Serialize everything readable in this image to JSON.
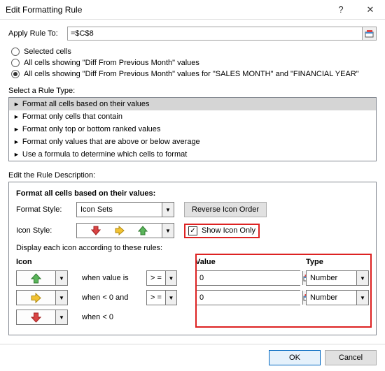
{
  "title": "Edit Formatting Rule",
  "apply": {
    "label": "Apply Rule To:",
    "value": "=$C$8"
  },
  "scope": {
    "opt1": "Selected cells",
    "opt2": "All cells showing \"Diff From Previous Month\" values",
    "opt3": "All cells showing \"Diff From Previous Month\" values for \"SALES MONTH\" and \"FINANCIAL YEAR\""
  },
  "select_type_label": "Select a Rule Type:",
  "rule_types": {
    "r0": "Format all cells based on their values",
    "r1": "Format only cells that contain",
    "r2": "Format only top or bottom ranked values",
    "r3": "Format only values that are above or below average",
    "r4": "Use a formula to determine which cells to format"
  },
  "edit_desc_label": "Edit the Rule Description:",
  "desc": {
    "heading": "Format all cells based on their values:",
    "format_style_label": "Format Style:",
    "format_style_value": "Icon Sets",
    "reverse_btn": "Reverse Icon Order",
    "icon_style_label": "Icon Style:",
    "show_icon_only": "Show Icon Only",
    "display_rules_label": "Display each icon according to these rules:",
    "headers": {
      "icon": "Icon",
      "value": "Value",
      "type": "Type"
    },
    "rows": {
      "r1": {
        "text": "when value is",
        "op": "> =",
        "value": "0",
        "type": "Number"
      },
      "r2": {
        "text": "when < 0 and",
        "op": "> =",
        "value": "0",
        "type": "Number"
      },
      "r3": {
        "text": "when < 0"
      }
    }
  },
  "footer": {
    "ok": "OK",
    "cancel": "Cancel"
  }
}
